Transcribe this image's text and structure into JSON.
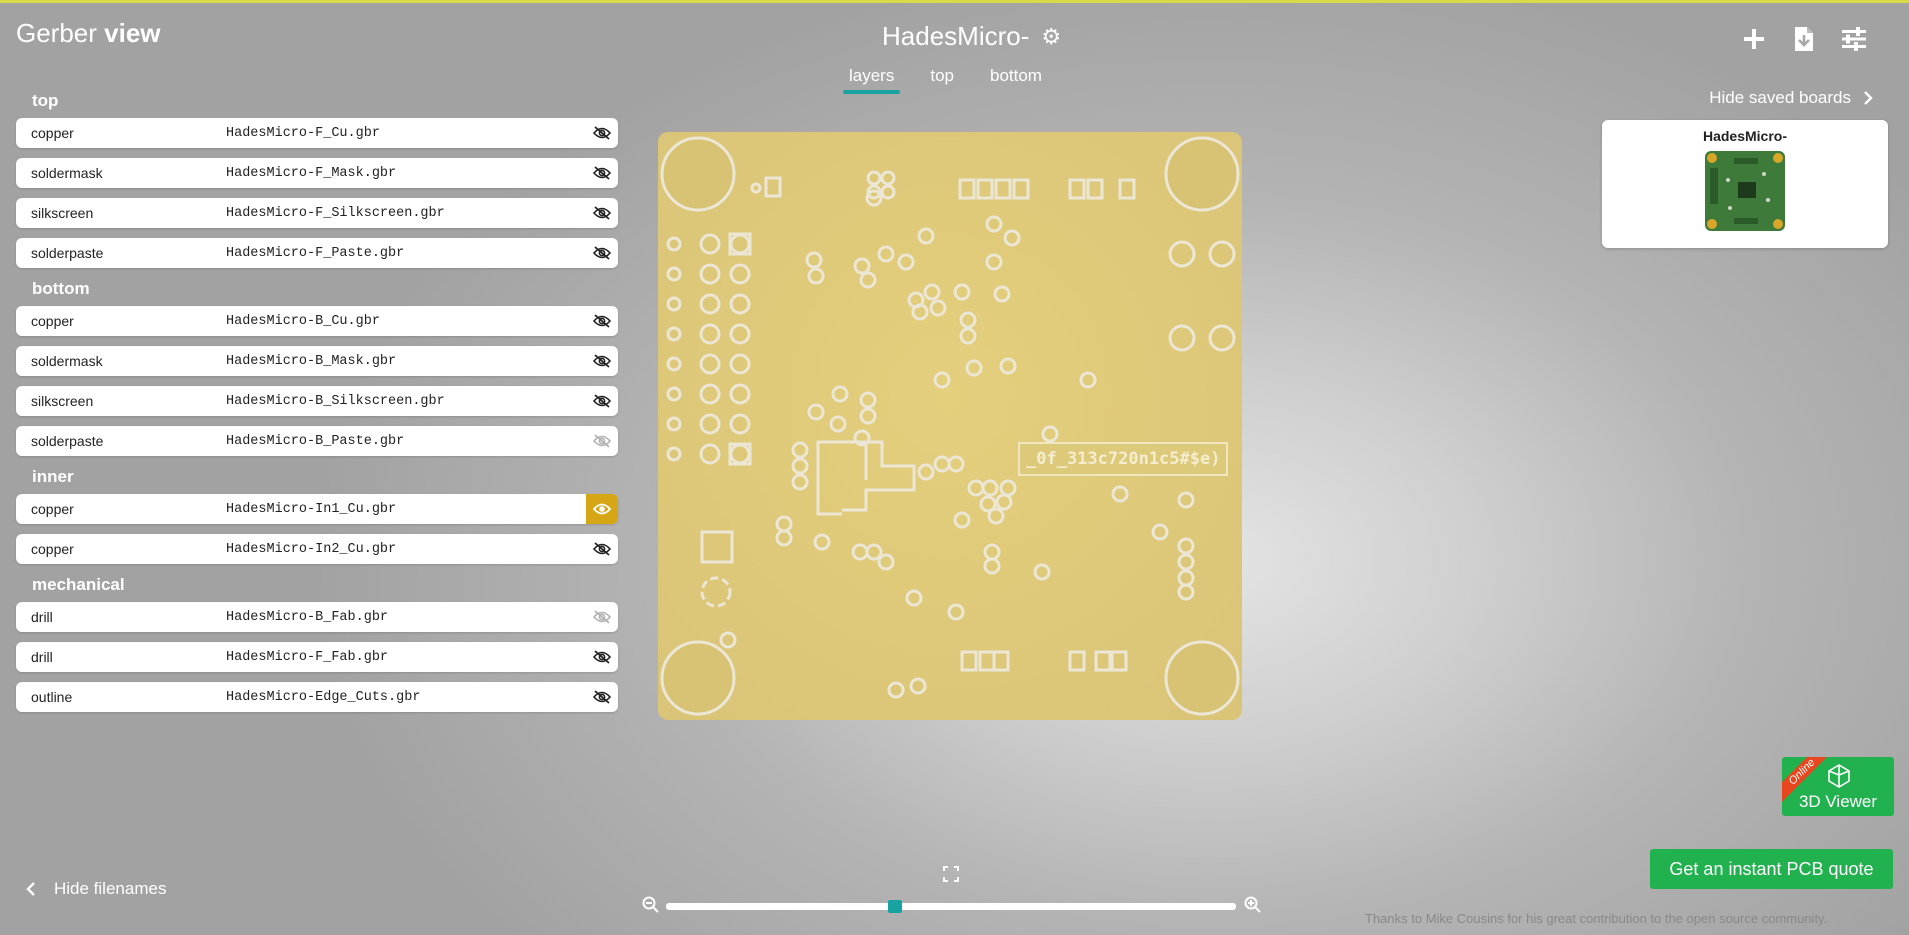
{
  "app": {
    "brand_light": "Gerber ",
    "brand_bold": "view"
  },
  "project": {
    "title": "HadesMicro-",
    "settings_icon": "gear-icon"
  },
  "tabs": [
    {
      "label": "layers",
      "active": true
    },
    {
      "label": "top",
      "active": false
    },
    {
      "label": "bottom",
      "active": false
    }
  ],
  "toolbar": {
    "icons": [
      "plus-icon",
      "download-file-icon",
      "settings-sliders-icon"
    ]
  },
  "saved_boards": {
    "toggle_label": "Hide saved boards",
    "boards": [
      {
        "name": "HadesMicro-"
      }
    ]
  },
  "layers": {
    "groups": [
      {
        "title": "top",
        "items": [
          {
            "type": "copper",
            "file": "HadesMicro-F_Cu.gbr",
            "visible": false
          },
          {
            "type": "soldermask",
            "file": "HadesMicro-F_Mask.gbr",
            "visible": false
          },
          {
            "type": "silkscreen",
            "file": "HadesMicro-F_Silkscreen.gbr",
            "visible": false
          },
          {
            "type": "solderpaste",
            "file": "HadesMicro-F_Paste.gbr",
            "visible": false
          }
        ]
      },
      {
        "title": "bottom",
        "items": [
          {
            "type": "copper",
            "file": "HadesMicro-B_Cu.gbr",
            "visible": false
          },
          {
            "type": "soldermask",
            "file": "HadesMicro-B_Mask.gbr",
            "visible": false
          },
          {
            "type": "silkscreen",
            "file": "HadesMicro-B_Silkscreen.gbr",
            "visible": false
          },
          {
            "type": "solderpaste",
            "file": "HadesMicro-B_Paste.gbr",
            "visible": false,
            "dim": true
          }
        ]
      },
      {
        "title": "inner",
        "items": [
          {
            "type": "copper",
            "file": "HadesMicro-In1_Cu.gbr",
            "visible": true
          },
          {
            "type": "copper",
            "file": "HadesMicro-In2_Cu.gbr",
            "visible": false
          }
        ]
      },
      {
        "title": "mechanical",
        "items": [
          {
            "type": "drill",
            "file": "HadesMicro-B_Fab.gbr",
            "visible": false,
            "dim": true
          },
          {
            "type": "drill",
            "file": "HadesMicro-F_Fab.gbr",
            "visible": false
          },
          {
            "type": "outline",
            "file": "HadesMicro-Edge_Cuts.gbr",
            "visible": false
          }
        ]
      }
    ]
  },
  "board": {
    "label_text": "_0f_313c720n1c5#$e)",
    "color": "#dcc97a"
  },
  "bottom_left": {
    "hide_filenames_label": "Hide filenames"
  },
  "zoom": {
    "level": 0.4
  },
  "viewer3d": {
    "badge": "Online",
    "label": "3D Viewer"
  },
  "quote": {
    "label": "Get an instant PCB quote"
  },
  "credits": {
    "text": "Thanks to Mike Cousins for his great contribution to the open source community."
  },
  "colors": {
    "accent": "#19a2a2",
    "active_eye": "#d7a614",
    "cta_green": "#21b24f",
    "ribbon": "#e8461e"
  }
}
